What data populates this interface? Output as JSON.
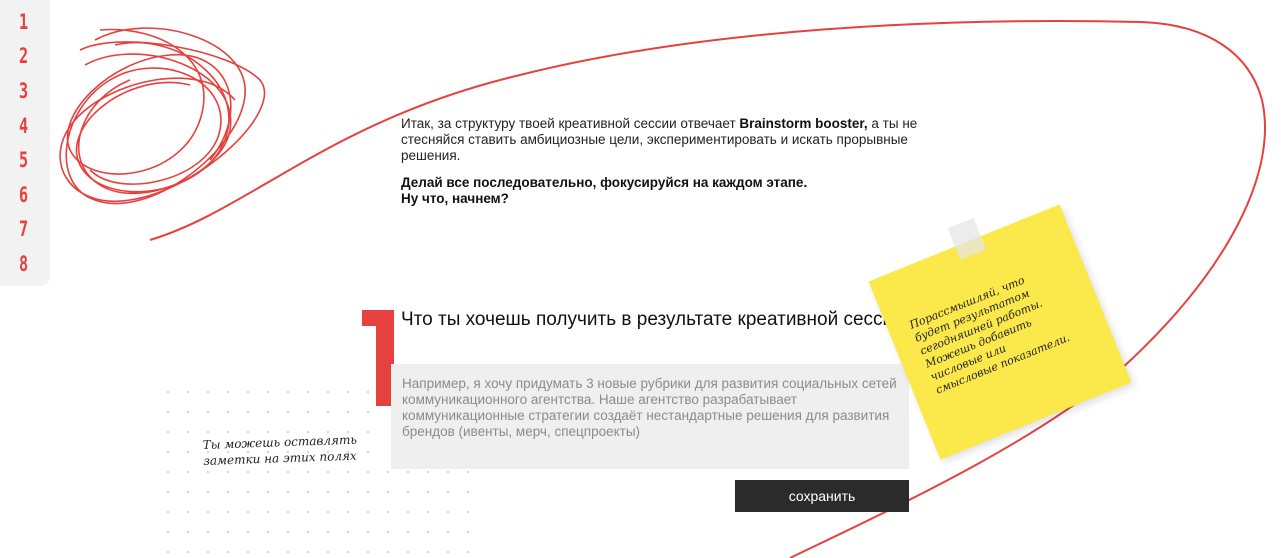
{
  "nav": {
    "steps": [
      "1",
      "2",
      "3",
      "4",
      "5",
      "6",
      "7",
      "8"
    ]
  },
  "intro": {
    "p1_text": "Итак, за структуру твоей креативной сессии отвечает ",
    "p1_bold": "Brainstorm booster,",
    "p1_rest": " а ты не стесняйся ставить амбициозные цели, экспериментировать и искать прорывные решения.",
    "p2_line1": "Делай все последовательно, фокусируйся на каждом этапе.",
    "p2_line2": "Ну что, начнем?"
  },
  "question": {
    "number": "1",
    "title": "Что ты хочешь получить в результате креативной сессии?",
    "answer_value": "",
    "answer_placeholder": "Например, я хочу придумать 3 новые рубрики для развития социальных сетей коммуникационного агентства. Наше агентство разрабатывает коммуникационные стратегии создаёт нестандартные решения для развития брендов (ивенты, мерч, спецпроекты)",
    "save_label": "сохранить"
  },
  "sticky_note": {
    "text": "Порассмышляй, что\nбудет результатом\nсегодняшней работы.\nМожешь добавить\nчисловые или\nсмысловые показатели."
  },
  "margin_note": {
    "text": "Ты можешь оставлять\nзаметки на этих полях"
  },
  "colors": {
    "accent": "#e6413e",
    "sticky": "#fbe84a",
    "button": "#2b2b2b",
    "field": "#efefef"
  }
}
